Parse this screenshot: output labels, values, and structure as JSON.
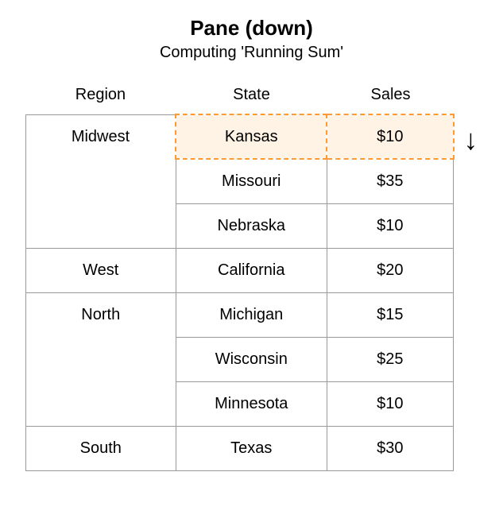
{
  "title": "Pane (down)",
  "subtitle": "Computing 'Running Sum'",
  "columns": {
    "region": "Region",
    "state": "State",
    "sales": "Sales"
  },
  "rows": [
    {
      "region": "Midwest",
      "state": "Kansas",
      "sales": "$10",
      "rowspan": 3,
      "highlight": true
    },
    {
      "region": null,
      "state": "Missouri",
      "sales": "$35"
    },
    {
      "region": null,
      "state": "Nebraska",
      "sales": "$10"
    },
    {
      "region": "West",
      "state": "California",
      "sales": "$20",
      "rowspan": 1
    },
    {
      "region": "North",
      "state": "Michigan",
      "sales": "$15",
      "rowspan": 3
    },
    {
      "region": null,
      "state": "Wisconsin",
      "sales": "$25"
    },
    {
      "region": null,
      "state": "Minnesota",
      "sales": "$10"
    },
    {
      "region": "South",
      "state": "Texas",
      "sales": "$30",
      "rowspan": 1
    }
  ],
  "arrow": "↓"
}
